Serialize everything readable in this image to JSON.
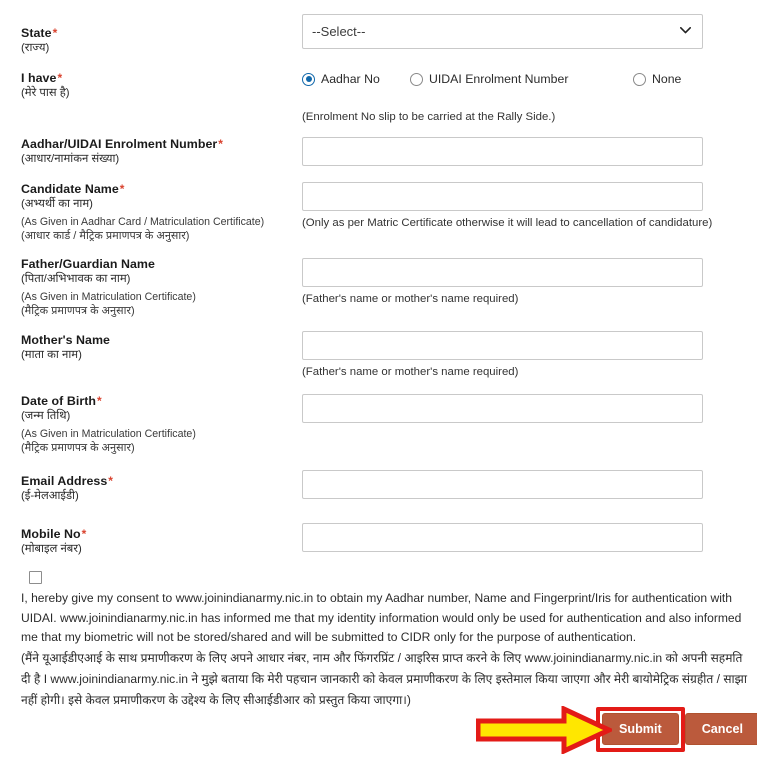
{
  "form": {
    "fields": {
      "state": {
        "label": "State",
        "required": true,
        "label_hi": "(राज्य)",
        "select_value": "--Select--",
        "options": [
          "--Select--"
        ]
      },
      "i_have": {
        "label": "I have",
        "required": true,
        "label_hi": "(मेरे पास है)",
        "options": [
          {
            "label": "Aadhar No",
            "selected": true
          },
          {
            "label": "UIDAI Enrolment Number",
            "selected": false
          },
          {
            "label": "None",
            "selected": false
          }
        ],
        "hint": "(Enrolment No slip to be carried at the Rally Side.)"
      },
      "aadhar_number": {
        "label": "Aadhar/UIDAI Enrolment Number",
        "required": true,
        "label_hi": "(आधार/नामांकन संख्या)",
        "value": "",
        "placeholder": ""
      },
      "candidate_name": {
        "label": "Candidate Name",
        "required": true,
        "label_hi": "(अभ्यर्थी का नाम)",
        "sub_en": "(As Given in Aadhar Card / Matriculation Certificate)",
        "sub_hi": "(आधार कार्ड / मैट्रिक प्रमाणपत्र के अनुसार)",
        "value": "",
        "placeholder": "",
        "hint": "(Only as per Matric Certificate otherwise it will lead to cancellation of candidature)"
      },
      "father_name": {
        "label": "Father/Guardian Name",
        "required": false,
        "label_hi": "(पिता/अभिभावक का नाम)",
        "sub_en": "(As Given in Matriculation Certificate)",
        "sub_hi": "(मैट्रिक प्रमाणपत्र के अनुसार)",
        "value": "",
        "placeholder": "",
        "hint": "(Father's name or mother's name required)"
      },
      "mother_name": {
        "label": "Mother's Name",
        "required": false,
        "label_hi": "(माता का नाम)",
        "value": "",
        "placeholder": "",
        "hint": "(Father's name or mother's name required)"
      },
      "date_of_birth": {
        "label": "Date of Birth",
        "required": true,
        "label_hi": "(जन्म तिथि)",
        "sub_en": "(As Given in Matriculation Certificate)",
        "sub_hi": "(मैट्रिक प्रमाणपत्र के अनुसार)",
        "value": "",
        "placeholder": ""
      },
      "email": {
        "label": "Email Address",
        "required": true,
        "label_hi": "(ई-मेलआईडी)",
        "value": "",
        "placeholder": ""
      },
      "mobile": {
        "label": "Mobile No",
        "required": true,
        "label_hi": "(मोबाइल नंबर)",
        "value": "",
        "placeholder": ""
      }
    },
    "consent": {
      "checked": false,
      "text_en": "I, hereby give my consent to www.joinindianarmy.nic.in to obtain my Aadhar number, Name and Fingerprint/Iris for authentication with UIDAI. www.joinindianarmy.nic.in has informed me that my identity information would only be used for authentication and also informed me that my biometric will not be stored/shared and will be submitted to CIDR only for the purpose of authentication.",
      "text_hi": "(मैंने यूआईडीएआई के साथ प्रमाणीकरण के लिए अपने आधार नंबर, नाम और फिंगरप्रिंट / आइरिस प्राप्त करने के लिए www.joinindianarmy.nic.in को अपनी सहमति दी है I www.joinindianarmy.nic.in ने मुझे बताया कि मेरी पहचान जानकारी को केवल प्रमाणीकरण के लिए इस्तेमाल किया जाएगा और मेरी बायोमेट्रिक संग्रहीत / साझा नहीं होगी। इसे केवल प्रमाणीकरण के उद्देश्य के लिए सीआईडीआर को प्रस्तुत किया जाएगा।)"
    },
    "buttons": {
      "submit": "Submit",
      "cancel": "Cancel"
    }
  },
  "annotation": {
    "arrow": "right-arrow-annotation",
    "arrow_fill": "#ffe700",
    "arrow_stroke": "#e31b17",
    "highlight_color": "#e31b17",
    "target": "Submit"
  },
  "colors": {
    "required_asterisk": "#d9432f",
    "button_bg": "#bb5a3c",
    "radio_selected": "#1168ab",
    "text": "#1a1a1a",
    "input_border": "#c9c9c9"
  }
}
